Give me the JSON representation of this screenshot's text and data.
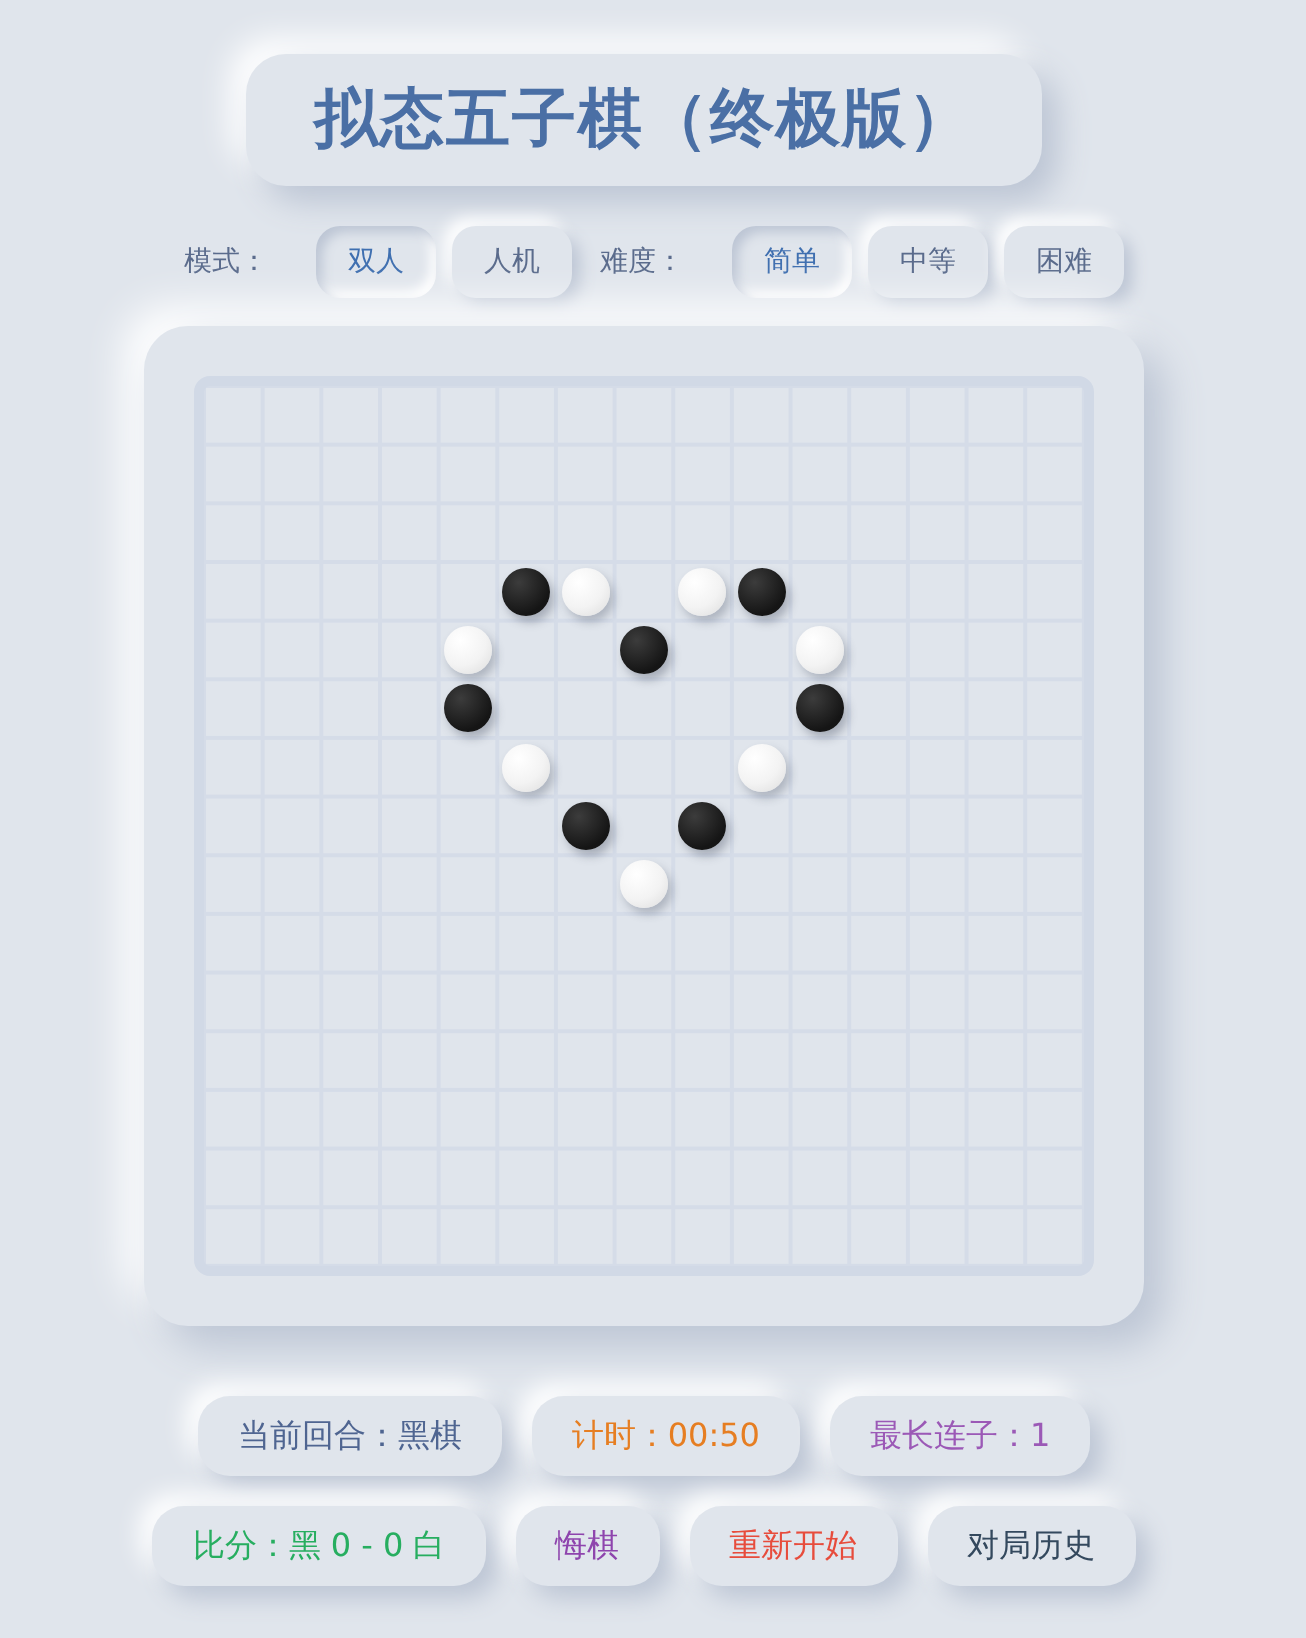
{
  "title": "拟态五子棋（终极版）",
  "mode": {
    "label": "模式：",
    "options": [
      {
        "label": "双人",
        "selected": true
      },
      {
        "label": "人机",
        "selected": false
      }
    ]
  },
  "difficulty": {
    "label": "难度：",
    "options": [
      {
        "label": "简单",
        "selected": true
      },
      {
        "label": "中等",
        "selected": false
      },
      {
        "label": "困难",
        "selected": false
      }
    ]
  },
  "board": {
    "rows": [
      [
        {
          "kind": "empty"
        },
        {
          "kind": "empty"
        },
        {
          "kind": "empty"
        },
        {
          "kind": "empty"
        },
        {
          "kind": "empty"
        },
        {
          "kind": "empty"
        },
        {
          "kind": "empty"
        },
        {
          "kind": "empty"
        },
        {
          "kind": "empty"
        },
        {
          "kind": "empty"
        },
        {
          "kind": "empty"
        },
        {
          "kind": "empty"
        },
        {
          "kind": "empty"
        },
        {
          "kind": "empty"
        },
        {
          "kind": "empty"
        }
      ],
      [
        {
          "kind": "empty"
        },
        {
          "kind": "empty"
        },
        {
          "kind": "empty"
        },
        {
          "kind": "empty"
        },
        {
          "kind": "empty"
        },
        {
          "kind": "empty"
        },
        {
          "kind": "empty"
        },
        {
          "kind": "empty"
        },
        {
          "kind": "empty"
        },
        {
          "kind": "empty"
        },
        {
          "kind": "empty"
        },
        {
          "kind": "empty"
        },
        {
          "kind": "empty"
        },
        {
          "kind": "empty"
        },
        {
          "kind": "empty"
        }
      ],
      [
        {
          "kind": "empty"
        },
        {
          "kind": "empty"
        },
        {
          "kind": "empty"
        },
        {
          "kind": "empty"
        },
        {
          "kind": "empty"
        },
        {
          "kind": "empty"
        },
        {
          "kind": "empty"
        },
        {
          "kind": "empty"
        },
        {
          "kind": "empty"
        },
        {
          "kind": "empty"
        },
        {
          "kind": "empty"
        },
        {
          "kind": "empty"
        },
        {
          "kind": "empty"
        },
        {
          "kind": "empty"
        },
        {
          "kind": "empty"
        }
      ],
      [
        {
          "kind": "empty"
        },
        {
          "kind": "empty"
        },
        {
          "kind": "empty"
        },
        {
          "kind": "empty"
        },
        {
          "kind": "empty"
        },
        {
          "kind": "black"
        },
        {
          "kind": "white"
        },
        {
          "kind": "empty"
        },
        {
          "kind": "white"
        },
        {
          "kind": "black"
        },
        {
          "kind": "empty"
        },
        {
          "kind": "empty"
        },
        {
          "kind": "empty"
        },
        {
          "kind": "empty"
        },
        {
          "kind": "empty"
        }
      ],
      [
        {
          "kind": "empty"
        },
        {
          "kind": "empty"
        },
        {
          "kind": "empty"
        },
        {
          "kind": "empty"
        },
        {
          "kind": "white"
        },
        {
          "kind": "empty"
        },
        {
          "kind": "empty"
        },
        {
          "kind": "black"
        },
        {
          "kind": "empty"
        },
        {
          "kind": "empty"
        },
        {
          "kind": "white"
        },
        {
          "kind": "empty"
        },
        {
          "kind": "empty"
        },
        {
          "kind": "empty"
        },
        {
          "kind": "empty"
        }
      ],
      [
        {
          "kind": "empty"
        },
        {
          "kind": "empty"
        },
        {
          "kind": "empty"
        },
        {
          "kind": "empty"
        },
        {
          "kind": "black"
        },
        {
          "kind": "empty"
        },
        {
          "kind": "empty"
        },
        {
          "kind": "empty"
        },
        {
          "kind": "empty"
        },
        {
          "kind": "empty"
        },
        {
          "kind": "black"
        },
        {
          "kind": "empty"
        },
        {
          "kind": "empty"
        },
        {
          "kind": "empty"
        },
        {
          "kind": "empty"
        }
      ],
      [
        {
          "kind": "empty"
        },
        {
          "kind": "empty"
        },
        {
          "kind": "empty"
        },
        {
          "kind": "empty"
        },
        {
          "kind": "empty"
        },
        {
          "kind": "white"
        },
        {
          "kind": "empty"
        },
        {
          "kind": "empty"
        },
        {
          "kind": "empty"
        },
        {
          "kind": "white"
        },
        {
          "kind": "empty"
        },
        {
          "kind": "empty"
        },
        {
          "kind": "empty"
        },
        {
          "kind": "empty"
        },
        {
          "kind": "empty"
        }
      ],
      [
        {
          "kind": "empty"
        },
        {
          "kind": "empty"
        },
        {
          "kind": "empty"
        },
        {
          "kind": "empty"
        },
        {
          "kind": "empty"
        },
        {
          "kind": "empty"
        },
        {
          "kind": "black"
        },
        {
          "kind": "empty"
        },
        {
          "kind": "black"
        },
        {
          "kind": "empty"
        },
        {
          "kind": "empty"
        },
        {
          "kind": "empty"
        },
        {
          "kind": "empty"
        },
        {
          "kind": "empty"
        },
        {
          "kind": "empty"
        }
      ],
      [
        {
          "kind": "empty"
        },
        {
          "kind": "empty"
        },
        {
          "kind": "empty"
        },
        {
          "kind": "empty"
        },
        {
          "kind": "empty"
        },
        {
          "kind": "empty"
        },
        {
          "kind": "empty"
        },
        {
          "kind": "white"
        },
        {
          "kind": "empty"
        },
        {
          "kind": "empty"
        },
        {
          "kind": "empty"
        },
        {
          "kind": "empty"
        },
        {
          "kind": "empty"
        },
        {
          "kind": "empty"
        },
        {
          "kind": "empty"
        }
      ],
      [
        {
          "kind": "empty"
        },
        {
          "kind": "empty"
        },
        {
          "kind": "empty"
        },
        {
          "kind": "empty"
        },
        {
          "kind": "empty"
        },
        {
          "kind": "empty"
        },
        {
          "kind": "empty"
        },
        {
          "kind": "empty"
        },
        {
          "kind": "empty"
        },
        {
          "kind": "empty"
        },
        {
          "kind": "empty"
        },
        {
          "kind": "empty"
        },
        {
          "kind": "empty"
        },
        {
          "kind": "empty"
        },
        {
          "kind": "empty"
        }
      ],
      [
        {
          "kind": "empty"
        },
        {
          "kind": "empty"
        },
        {
          "kind": "empty"
        },
        {
          "kind": "empty"
        },
        {
          "kind": "empty"
        },
        {
          "kind": "empty"
        },
        {
          "kind": "empty"
        },
        {
          "kind": "empty"
        },
        {
          "kind": "empty"
        },
        {
          "kind": "empty"
        },
        {
          "kind": "empty"
        },
        {
          "kind": "empty"
        },
        {
          "kind": "empty"
        },
        {
          "kind": "empty"
        },
        {
          "kind": "empty"
        }
      ],
      [
        {
          "kind": "empty"
        },
        {
          "kind": "empty"
        },
        {
          "kind": "empty"
        },
        {
          "kind": "empty"
        },
        {
          "kind": "empty"
        },
        {
          "kind": "empty"
        },
        {
          "kind": "empty"
        },
        {
          "kind": "empty"
        },
        {
          "kind": "empty"
        },
        {
          "kind": "empty"
        },
        {
          "kind": "empty"
        },
        {
          "kind": "empty"
        },
        {
          "kind": "empty"
        },
        {
          "kind": "empty"
        },
        {
          "kind": "empty"
        }
      ],
      [
        {
          "kind": "empty"
        },
        {
          "kind": "empty"
        },
        {
          "kind": "empty"
        },
        {
          "kind": "empty"
        },
        {
          "kind": "empty"
        },
        {
          "kind": "empty"
        },
        {
          "kind": "empty"
        },
        {
          "kind": "empty"
        },
        {
          "kind": "empty"
        },
        {
          "kind": "empty"
        },
        {
          "kind": "empty"
        },
        {
          "kind": "empty"
        },
        {
          "kind": "empty"
        },
        {
          "kind": "empty"
        },
        {
          "kind": "empty"
        }
      ],
      [
        {
          "kind": "empty"
        },
        {
          "kind": "empty"
        },
        {
          "kind": "empty"
        },
        {
          "kind": "empty"
        },
        {
          "kind": "empty"
        },
        {
          "kind": "empty"
        },
        {
          "kind": "empty"
        },
        {
          "kind": "empty"
        },
        {
          "kind": "empty"
        },
        {
          "kind": "empty"
        },
        {
          "kind": "empty"
        },
        {
          "kind": "empty"
        },
        {
          "kind": "empty"
        },
        {
          "kind": "empty"
        },
        {
          "kind": "empty"
        }
      ],
      [
        {
          "kind": "empty"
        },
        {
          "kind": "empty"
        },
        {
          "kind": "empty"
        },
        {
          "kind": "empty"
        },
        {
          "kind": "empty"
        },
        {
          "kind": "empty"
        },
        {
          "kind": "empty"
        },
        {
          "kind": "empty"
        },
        {
          "kind": "empty"
        },
        {
          "kind": "empty"
        },
        {
          "kind": "empty"
        },
        {
          "kind": "empty"
        },
        {
          "kind": "empty"
        },
        {
          "kind": "empty"
        },
        {
          "kind": "empty"
        }
      ]
    ]
  },
  "status": [
    {
      "text": "当前回合：黑棋",
      "color": "#4f6591"
    },
    {
      "text": "计时：00:50",
      "color": "#e67e22"
    },
    {
      "text": "最长连子：1",
      "color": "#9b59b6"
    },
    {
      "text": "比分：黑 0 - 0 白",
      "color": "#27ae60"
    }
  ],
  "actions": [
    {
      "label": "悔棋",
      "color": "#8e44ad"
    },
    {
      "label": "重新开始",
      "color": "#e74c3c"
    },
    {
      "label": "对局历史",
      "color": "#34495e"
    }
  ]
}
